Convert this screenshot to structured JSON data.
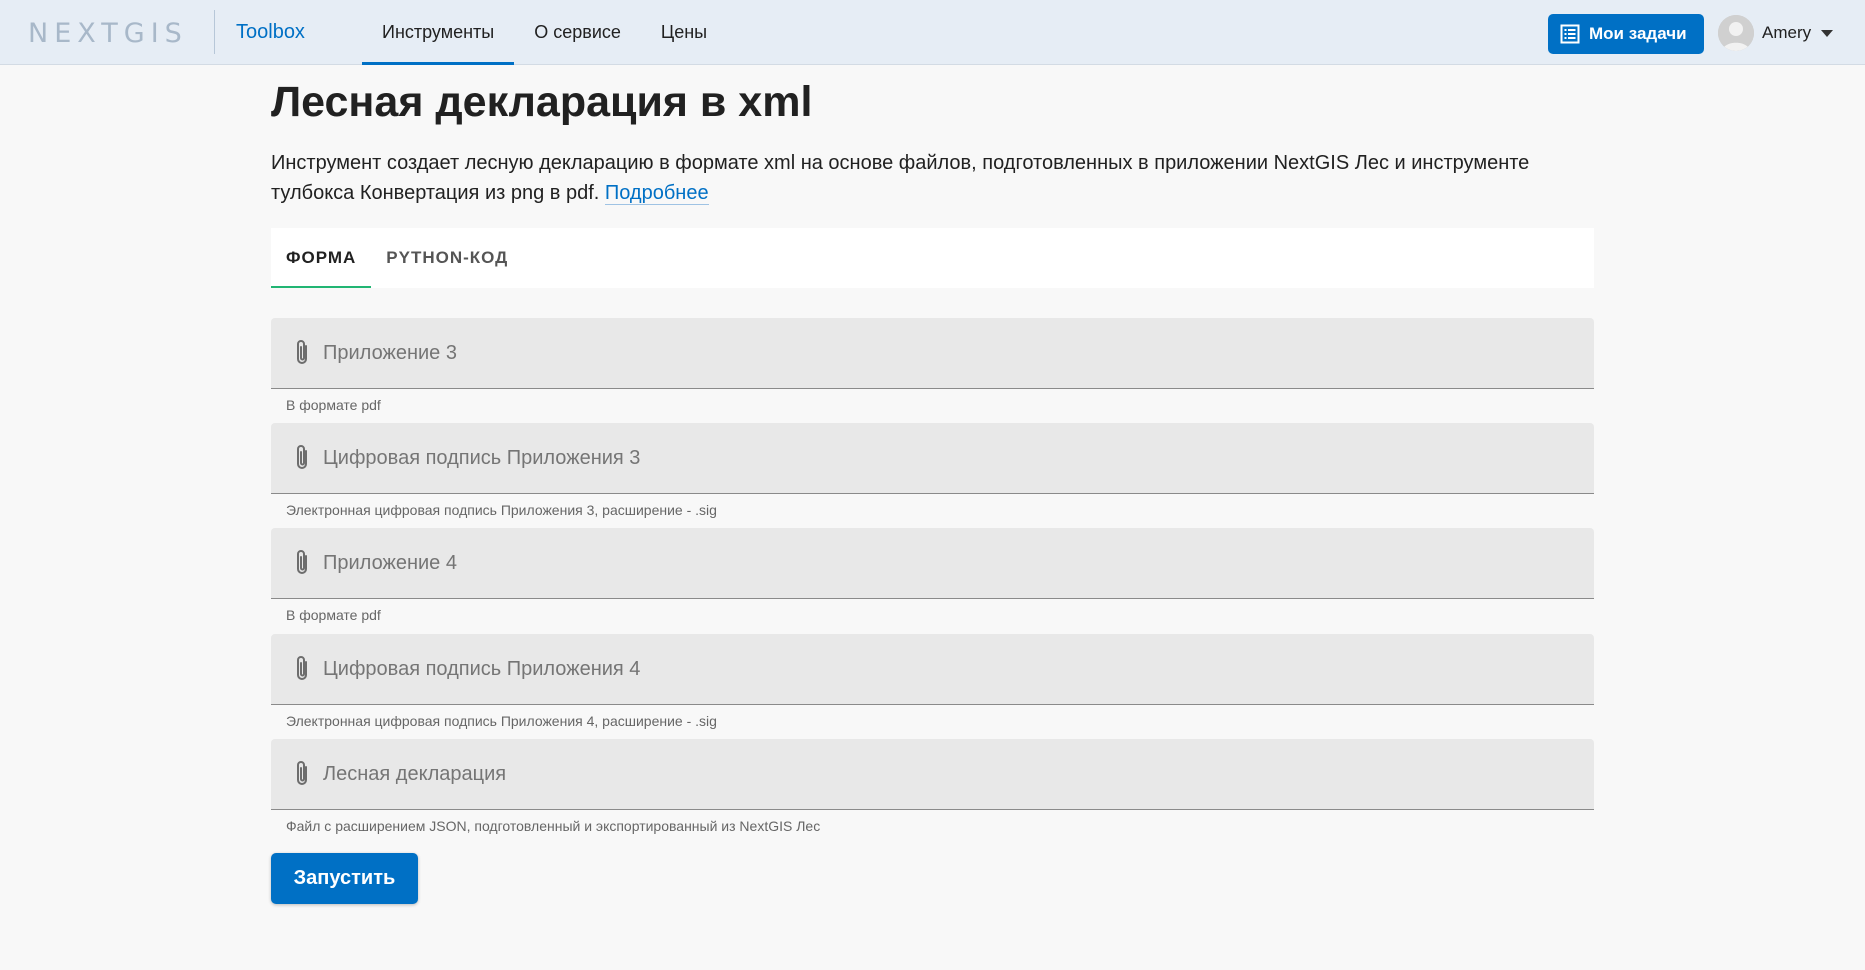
{
  "header": {
    "logo_text": "NEXTGIS",
    "product_name": "Toolbox",
    "nav": [
      {
        "label": "Инструменты",
        "active": true
      },
      {
        "label": "О сервисе",
        "active": false
      },
      {
        "label": "Цены",
        "active": false
      }
    ],
    "tasks_button_label": "Мои задачи",
    "tasks_icon": "list-icon",
    "user_name": "Amery",
    "avatar_icon": "user-avatar-icon"
  },
  "page": {
    "title": "Лесная декларация в xml",
    "intro_text": "Инструмент создает лесную декларацию в формате xml на основе файлов, подготовленных в приложении NextGIS Лес и инструменте тулбокса Конвертация из png в pdf.",
    "more_link_label": "Подробнее"
  },
  "tabs": [
    {
      "label": "ФОРМА",
      "active": true
    },
    {
      "label": "PYTHON-КОД",
      "active": false
    }
  ],
  "fields": [
    {
      "label": "Приложение 3",
      "hint": "В формате pdf",
      "icon": "paperclip-icon"
    },
    {
      "label": "Цифровая подпись Приложения 3",
      "hint": "Электронная цифровая подпись Приложения 3, расширение - .sig",
      "icon": "paperclip-icon"
    },
    {
      "label": "Приложение 4",
      "hint": "В формате pdf",
      "icon": "paperclip-icon"
    },
    {
      "label": "Цифровая подпись Приложения 4",
      "hint": "Электронная цифровая подпись Приложения 4, расширение - .sig",
      "icon": "paperclip-icon"
    },
    {
      "label": "Лесная декларация",
      "hint": "Файл с расширением JSON, подготовленный и экспортированный из NextGIS Лес",
      "icon": "paperclip-icon"
    }
  ],
  "run_button_label": "Запустить",
  "colors": {
    "accent": "#0070c5",
    "header_bg": "#e6edf5",
    "tab_underline": "#21b573",
    "field_bg": "#e8e8e8"
  }
}
